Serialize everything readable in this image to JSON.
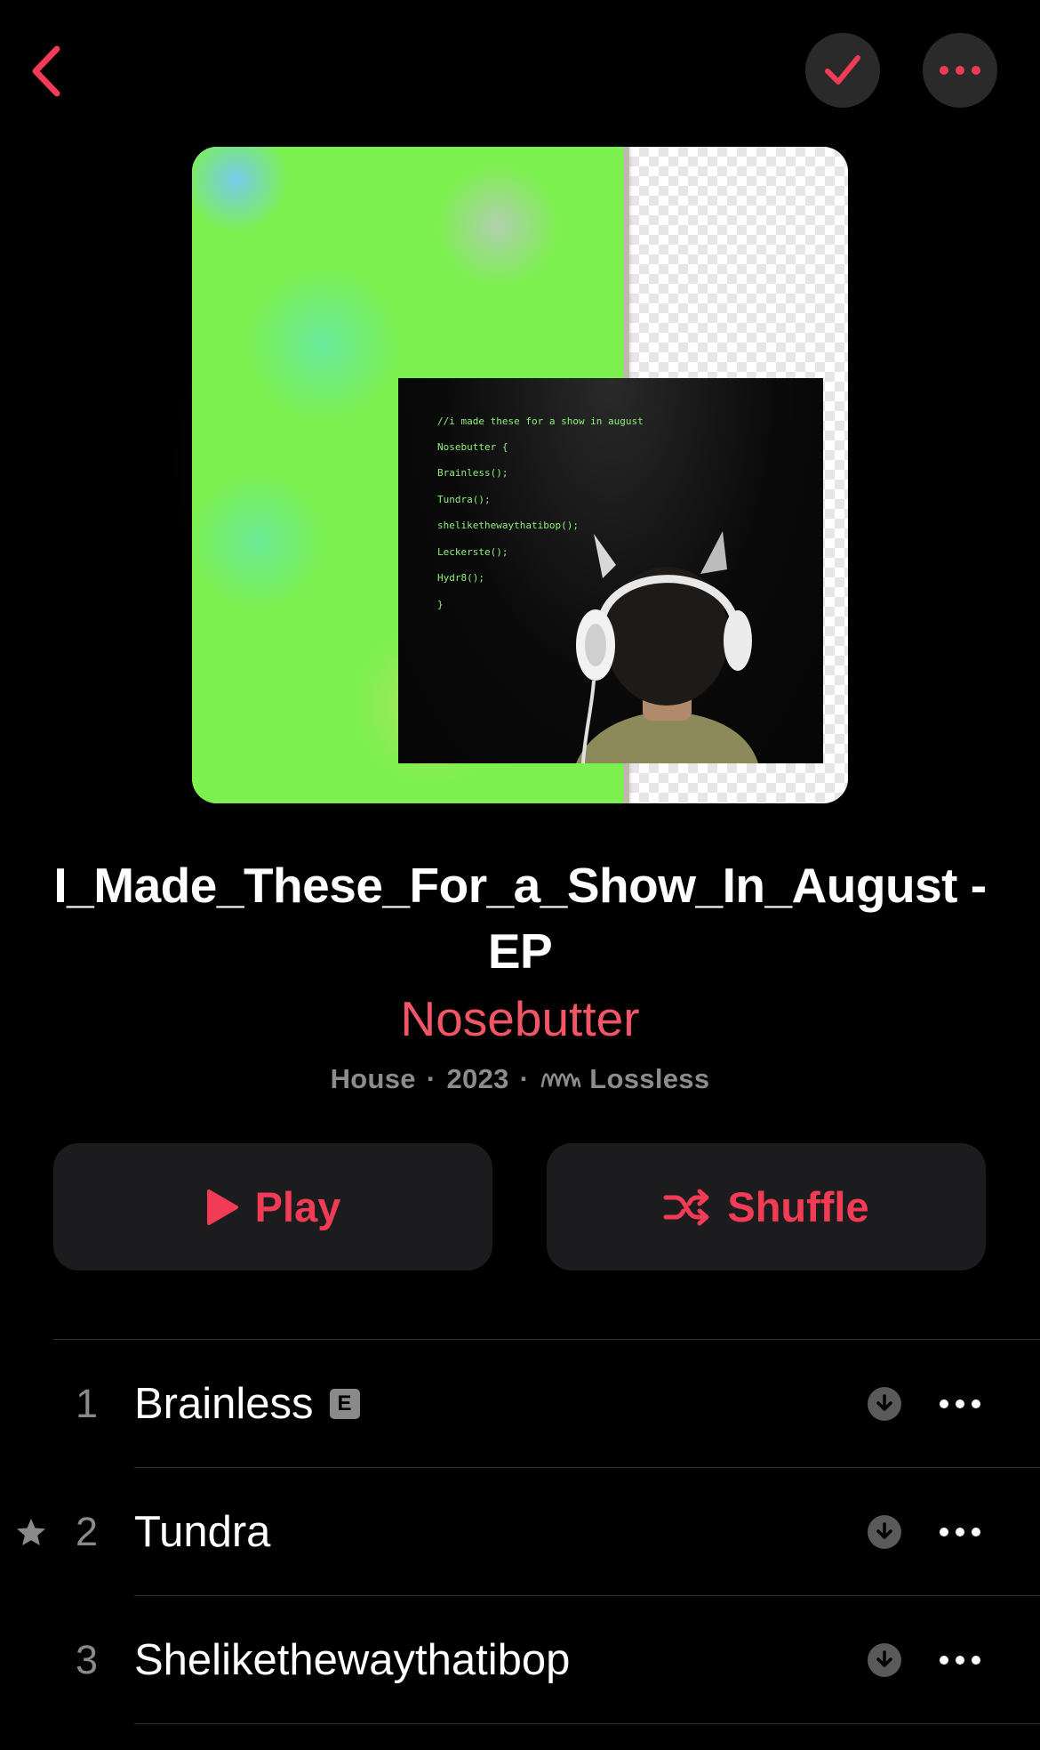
{
  "nav": {
    "back_icon": "chevron-left-icon",
    "added_icon": "checkmark-icon",
    "more_icon": "ellipsis-icon"
  },
  "artwork": {
    "code_lines": [
      "//i made these for a show in august",
      "Nosebutter {",
      "Brainless();",
      "Tundra();",
      "shelikethewaythatibop();",
      "Leckerste();",
      "Hydr8();",
      "}"
    ]
  },
  "album": {
    "title": "I_Made_These_For_a_Show_In_August - EP",
    "artist": "Nosebutter",
    "genre": "House",
    "year": "2023",
    "separator": "·",
    "quality": "Lossless"
  },
  "actions": {
    "play_label": "Play",
    "shuffle_label": "Shuffle"
  },
  "tracks": [
    {
      "number": "1",
      "title": "Brainless",
      "explicit": true,
      "explicit_label": "E",
      "favorite": false
    },
    {
      "number": "2",
      "title": "Tundra",
      "explicit": false,
      "favorite": true
    },
    {
      "number": "3",
      "title": "Shelikethewaythatibop",
      "explicit": false,
      "favorite": false
    }
  ],
  "colors": {
    "accent": "#f23b55",
    "artist": "#f25565",
    "background": "#000000",
    "button_bg": "#1c1c1e",
    "secondary_text": "#8c8c8c"
  }
}
